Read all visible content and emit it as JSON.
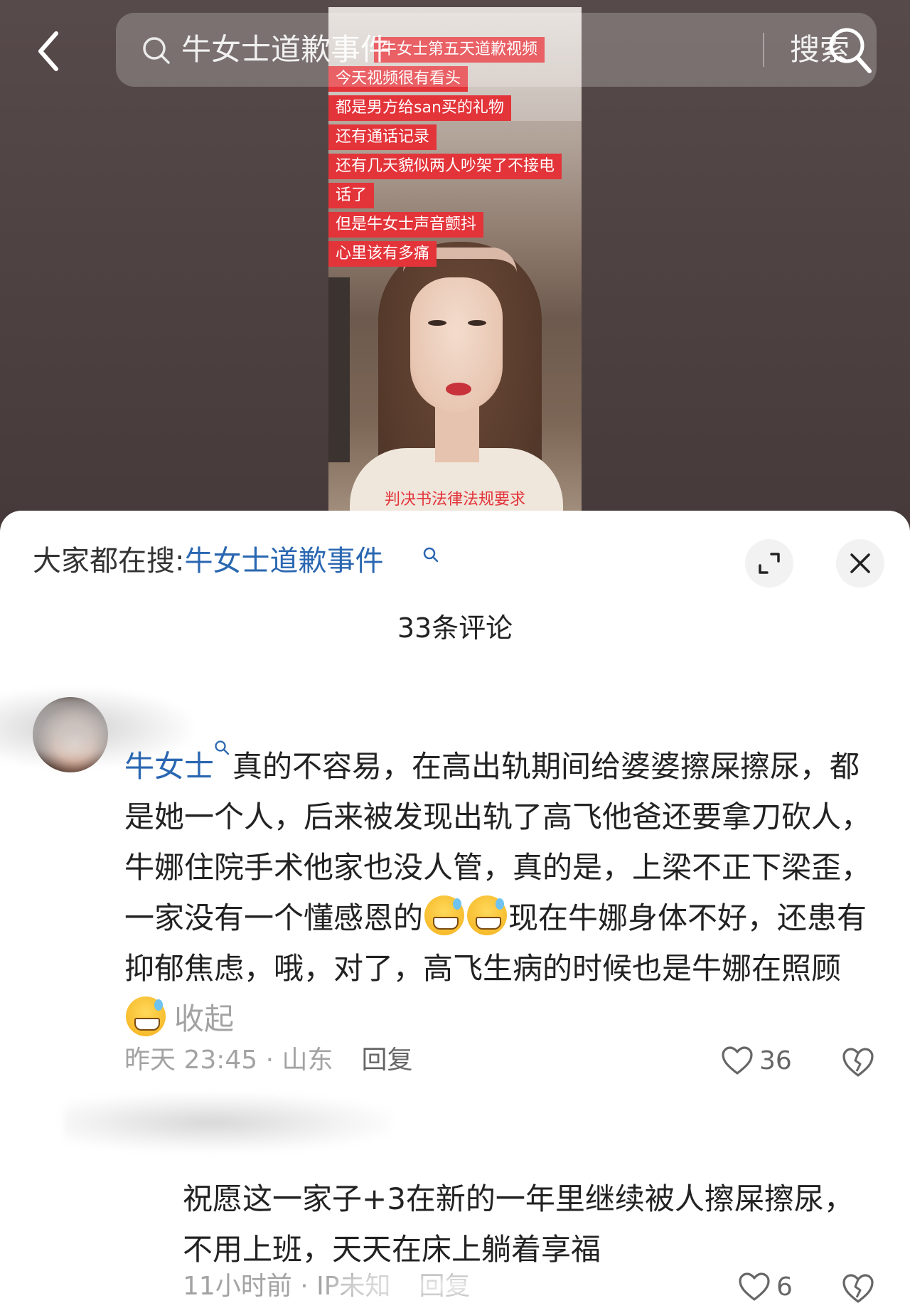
{
  "top_nav": {
    "search_query": "牛女士道歉事件",
    "search_button_label": "搜索"
  },
  "video": {
    "captions": [
      "牛女士第五天道歉视频",
      "今天视频很有看头",
      "都是男方给san买的礼物",
      "还有通话记录",
      "还有几天貌似两人吵架了不接电",
      "话了",
      "但是牛女士声音颤抖",
      "心里该有多痛"
    ],
    "bottom_caption": "判决书法律法规要求"
  },
  "sheet": {
    "trending_prefix": "大家都在搜:",
    "trending_link": "牛女士道歉事件",
    "comment_count": "33条评论"
  },
  "comments": [
    {
      "author_mention": "牛女士",
      "text_part1": "真的不容易，在高出轨期间给婆婆擦屎擦尿，都是她一个人，后来被发现出轨了高飞他爸还要拿刀砍人，牛娜住院手术他家也没人管，真的是，上梁不正下梁歪，一家没有一个懂感恩的",
      "text_part2": "现在牛娜身体不好，还患有抑郁焦虑，哦，对了，高飞生病的时候也是牛娜在照顾",
      "collapse_label": "收起",
      "meta": "昨天 23:45 · 山东",
      "reply_label": "回复",
      "likes": "36"
    },
    {
      "text": "祝愿这一家子+3在新的一年里继续被人擦屎擦尿，不用上班，天天在床上躺着享福",
      "meta": "11小时前 · IP未知",
      "reply_label": "回复",
      "likes": "6"
    }
  ],
  "colors": {
    "link_blue": "#2a67b1",
    "caption_red": "#e3343a",
    "meta_gray": "#a3a3a3"
  }
}
